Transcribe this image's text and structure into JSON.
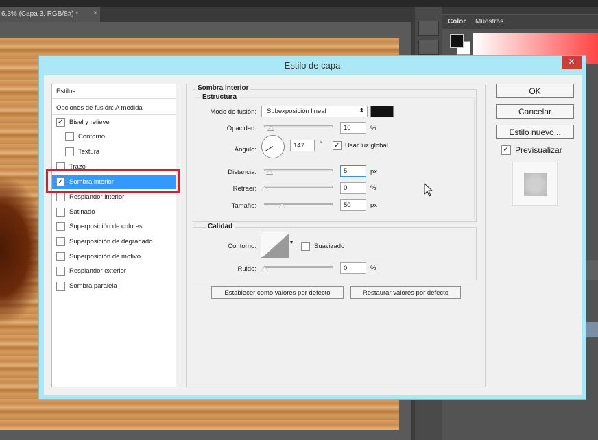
{
  "document": {
    "tab_title": "6,3% (Capa 3, RGB/8#) *",
    "close_symbol": "×"
  },
  "color_panel": {
    "tabs": [
      "Color",
      "Muestras"
    ]
  },
  "dialog": {
    "title": "Estilo de capa",
    "close_symbol": "✕",
    "accent_color": "#a9e8f4",
    "styles_list": {
      "header": "Estilos",
      "blend_options": "Opciones de fusión: A medida",
      "items": [
        {
          "label": "Bisel y relieve",
          "checked": true
        },
        {
          "label": "Contorno",
          "checked": false
        },
        {
          "label": "Textura",
          "checked": false
        },
        {
          "label": "Trazo",
          "checked": false
        },
        {
          "label": "Sombra interior",
          "checked": true,
          "selected": true
        },
        {
          "label": "Resplandor interior",
          "checked": false
        },
        {
          "label": "Satinado",
          "checked": false
        },
        {
          "label": "Superposición de colores",
          "checked": false
        },
        {
          "label": "Superposición de degradado",
          "checked": false
        },
        {
          "label": "Superposición de motivo",
          "checked": false
        },
        {
          "label": "Resplandor exterior",
          "checked": false
        },
        {
          "label": "Sombra paralela",
          "checked": false
        }
      ]
    },
    "inner_shadow": {
      "section_title": "Sombra interior",
      "structure": {
        "title": "Estructura",
        "blend_mode_label": "Modo de fusión:",
        "blend_mode_value": "Subexposición lineal",
        "shadow_color": "#111111",
        "opacity_label": "Opacidad:",
        "opacity_value": "10",
        "opacity_unit": "%",
        "opacity_fraction": 0.1,
        "angle_label": "Ángulo:",
        "angle_value": "147",
        "angle_unit": "°",
        "global_light_label": "Usar luz global",
        "global_light_checked": true,
        "distance_label": "Distancia:",
        "distance_value": "5",
        "distance_unit": "px",
        "choke_label": "Retraer:",
        "choke_value": "0",
        "choke_unit": "%",
        "size_label": "Tamaño:",
        "size_value": "50",
        "size_unit": "px"
      },
      "quality": {
        "title": "Calidad",
        "contour_label": "Contorno:",
        "antialias_label": "Suavizado",
        "antialias_checked": false,
        "noise_label": "Ruido:",
        "noise_value": "0",
        "noise_unit": "%"
      },
      "set_default_label": "Establecer como valores por defecto",
      "reset_default_label": "Restaurar valores por defecto"
    },
    "buttons": {
      "ok": "OK",
      "cancel": "Cancelar",
      "new_style": "Estilo nuevo...",
      "preview_label": "Previsualizar",
      "preview_checked": true
    }
  }
}
